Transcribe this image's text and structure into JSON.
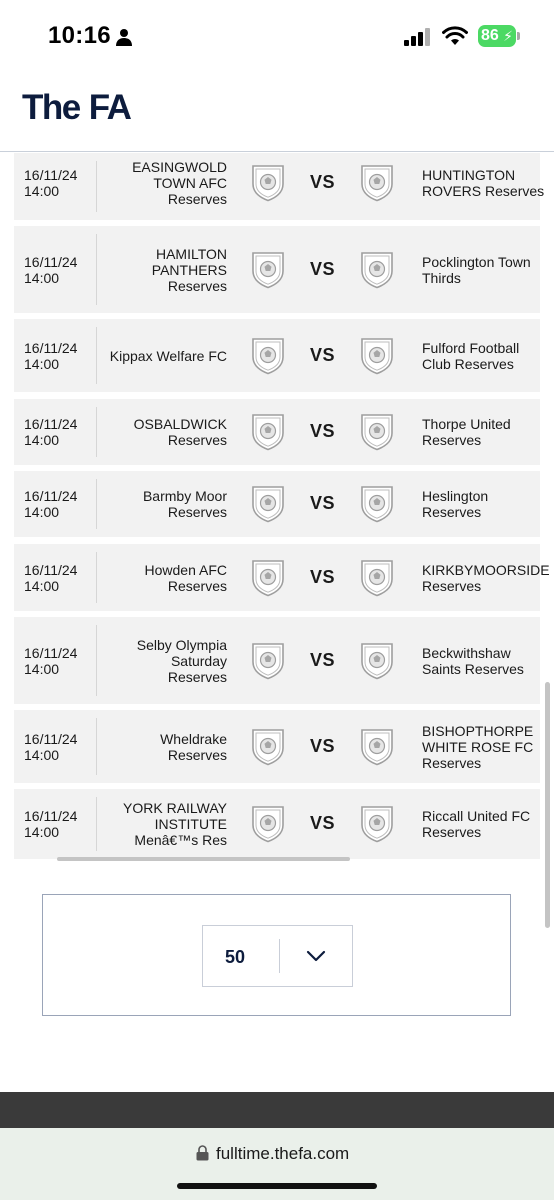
{
  "status_bar": {
    "time": "10:16",
    "battery": "86"
  },
  "header": {
    "logo_the": "The",
    "logo_fa": "FA"
  },
  "fixtures": [
    {
      "date": "16/11/24",
      "time": "14:00",
      "home": [
        "EASINGWOLD",
        "TOWN AFC",
        "Reserves"
      ],
      "away": [
        "HUNTINGTON",
        "ROVERS Reserves"
      ],
      "vs": "VS"
    },
    {
      "date": "16/11/24",
      "time": "14:00",
      "home": [
        "HAMILTON",
        "PANTHERS",
        "Reserves"
      ],
      "away": [
        "Pocklington Town",
        "Thirds"
      ],
      "vs": "VS"
    },
    {
      "date": "16/11/24",
      "time": "14:00",
      "home": [
        "Kippax Welfare FC"
      ],
      "away": [
        "Fulford Football",
        "Club Reserves"
      ],
      "vs": "VS"
    },
    {
      "date": "16/11/24",
      "time": "14:00",
      "home": [
        "OSBALDWICK",
        "Reserves"
      ],
      "away": [
        "Thorpe United",
        "Reserves"
      ],
      "vs": "VS"
    },
    {
      "date": "16/11/24",
      "time": "14:00",
      "home": [
        "Barmby Moor",
        "Reserves"
      ],
      "away": [
        "Heslington",
        "Reserves"
      ],
      "vs": "VS"
    },
    {
      "date": "16/11/24",
      "time": "14:00",
      "home": [
        "Howden AFC",
        "Reserves"
      ],
      "away": [
        "KIRKBYMOORSIDE",
        "Reserves"
      ],
      "vs": "VS"
    },
    {
      "date": "16/11/24",
      "time": "14:00",
      "home": [
        "Selby Olympia",
        "Saturday",
        "Reserves"
      ],
      "away": [
        "Beckwithshaw",
        "Saints Reserves"
      ],
      "vs": "VS"
    },
    {
      "date": "16/11/24",
      "time": "14:00",
      "home": [
        "Wheldrake",
        "Reserves"
      ],
      "away": [
        "BISHOPTHORPE",
        "WHITE ROSE FC",
        "Reserves"
      ],
      "vs": "VS"
    },
    {
      "date": "16/11/24",
      "time": "14:00",
      "home": [
        "YORK RAILWAY",
        "INSTITUTE",
        "Menâ€™s Res"
      ],
      "away": [
        "Riccall United FC",
        "Reserves"
      ],
      "vs": "VS"
    }
  ],
  "pager": {
    "page_size": "50"
  },
  "browser": {
    "url": "fulltime.thefa.com"
  },
  "colors": {
    "brand_navy": "#0d1c3d",
    "row_bg": "#f2f2f2",
    "battery_green": "#4cd964"
  }
}
